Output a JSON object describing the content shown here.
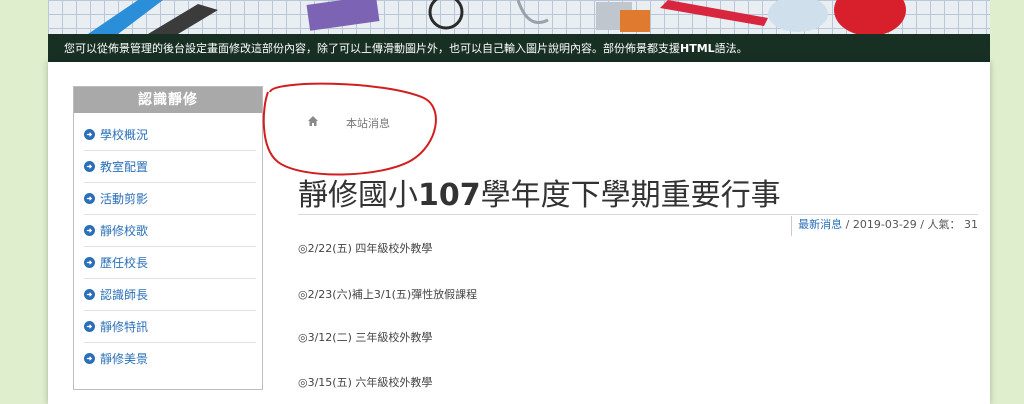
{
  "banner": {
    "caption_prefix": "您可以從佈景管理的後台設定畫面修改這部份內容，除了可以上傳滑動圖片外，也可以自己輸入圖片說明內容。部份佈景都支援",
    "caption_bold": "HTML",
    "caption_suffix": "語法。"
  },
  "sidebar": {
    "title": "認識靜修",
    "items": [
      {
        "label": "學校概況"
      },
      {
        "label": "教室配置"
      },
      {
        "label": "活動剪影"
      },
      {
        "label": "靜修校歌"
      },
      {
        "label": "歷任校長"
      },
      {
        "label": "認識師長"
      },
      {
        "label": "靜修特訊"
      },
      {
        "label": "靜修美景"
      }
    ]
  },
  "breadcrumb": {
    "home_icon": "home-icon",
    "current": "本站消息"
  },
  "article": {
    "title_pre": "靜修國小",
    "title_num": "107",
    "title_post": "學年度下學期重要行事",
    "category": "最新消息",
    "meta_rest": " / 2019-03-29 / 人氣： 31",
    "lines": [
      "◎2/22(五) 四年級校外教學",
      "◎2/23(六)補上3/1(五)彈性放假課程",
      "◎3/12(二) 三年級校外教學",
      "◎3/15(五) 六年級校外教學"
    ]
  },
  "colors": {
    "link": "#2a6fb8",
    "annotation": "#d21e1e",
    "banner_green": "#2f5f46"
  }
}
